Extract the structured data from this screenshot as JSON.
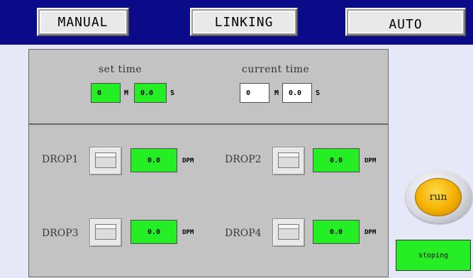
{
  "header": {
    "manual_label": "MANUAL",
    "linking_label": "LINKING",
    "auto_label": "AUTO",
    "background_color": "#0b0b8a"
  },
  "time_panel": {
    "set_time_caption": "set time",
    "current_time_caption": "current time",
    "set_minutes": "0",
    "set_seconds": "0.0",
    "current_minutes": "0",
    "current_seconds": "0.0",
    "minutes_unit": "M",
    "seconds_unit": "S"
  },
  "drops": [
    {
      "label": "DROP1",
      "value": "0.0",
      "unit": "DPM"
    },
    {
      "label": "DROP2",
      "value": "0.0",
      "unit": "DPM"
    },
    {
      "label": "DROP3",
      "value": "0.0",
      "unit": "DPM"
    },
    {
      "label": "DROP4",
      "value": "0.0",
      "unit": "DPM"
    }
  ],
  "run_button": {
    "label": "run",
    "color": "#f4b000"
  },
  "status": {
    "text": "stoping",
    "color": "#25ee25"
  }
}
